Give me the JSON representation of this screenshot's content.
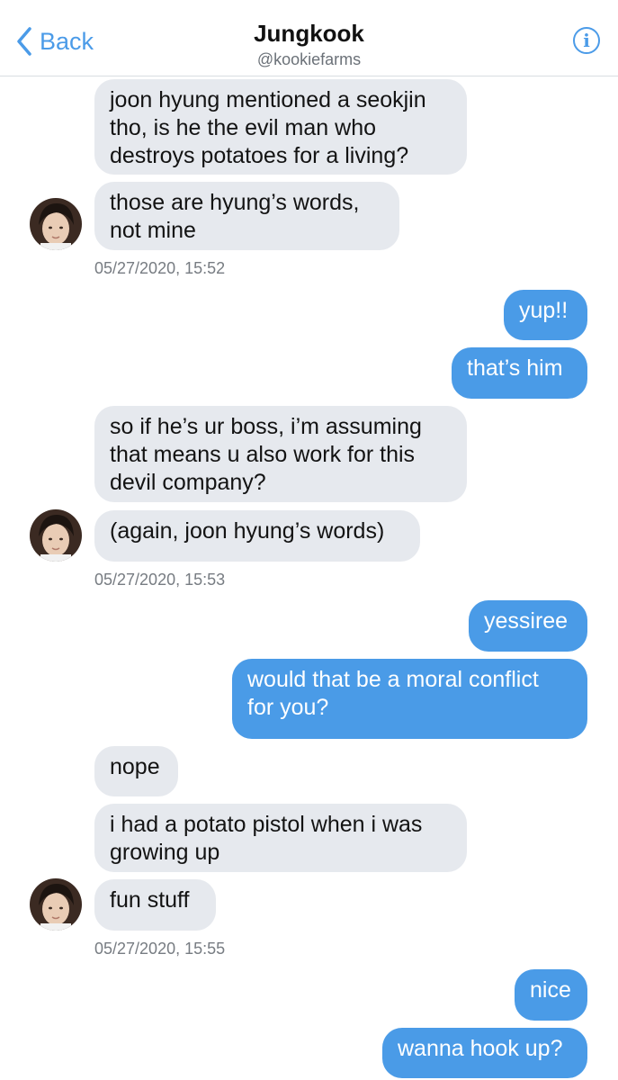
{
  "header": {
    "back_label": "Back",
    "title": "Jungkook",
    "handle": "@kookiefarms",
    "info_icon": "i"
  },
  "messages": [
    {
      "from": "them",
      "lines": [
        "joon hyung mentioned a seokjin",
        "tho, is he the evil man who",
        "destroys potatoes for a living?"
      ]
    },
    {
      "from": "them",
      "lines": [
        "those are hyung’s words,",
        "not mine"
      ]
    },
    {
      "from": "me",
      "lines": [
        "yup!!"
      ]
    },
    {
      "from": "me",
      "lines": [
        "that’s him"
      ]
    },
    {
      "from": "them",
      "lines": [
        "so if he’s ur boss, i’m assuming",
        "that means u also work for this",
        "devil company?"
      ]
    },
    {
      "from": "them",
      "lines": [
        "(again, joon hyung’s words)"
      ]
    },
    {
      "from": "me",
      "lines": [
        "yessiree"
      ]
    },
    {
      "from": "me",
      "lines": [
        "would that be a moral conflict",
        "for you?"
      ]
    },
    {
      "from": "them",
      "lines": [
        "nope"
      ]
    },
    {
      "from": "them",
      "lines": [
        "i had a potato pistol when i was",
        "growing up"
      ]
    },
    {
      "from": "them",
      "lines": [
        "fun stuff"
      ]
    },
    {
      "from": "me",
      "lines": [
        "nice"
      ]
    },
    {
      "from": "me",
      "lines": [
        "wanna hook up?"
      ]
    }
  ],
  "timestamps": [
    "05/27/2020, 15:52",
    "05/27/2020, 15:53",
    "05/27/2020, 15:55"
  ],
  "colors": {
    "accent": "#4a9be7",
    "incoming_bubble": "#e6e9ee"
  }
}
